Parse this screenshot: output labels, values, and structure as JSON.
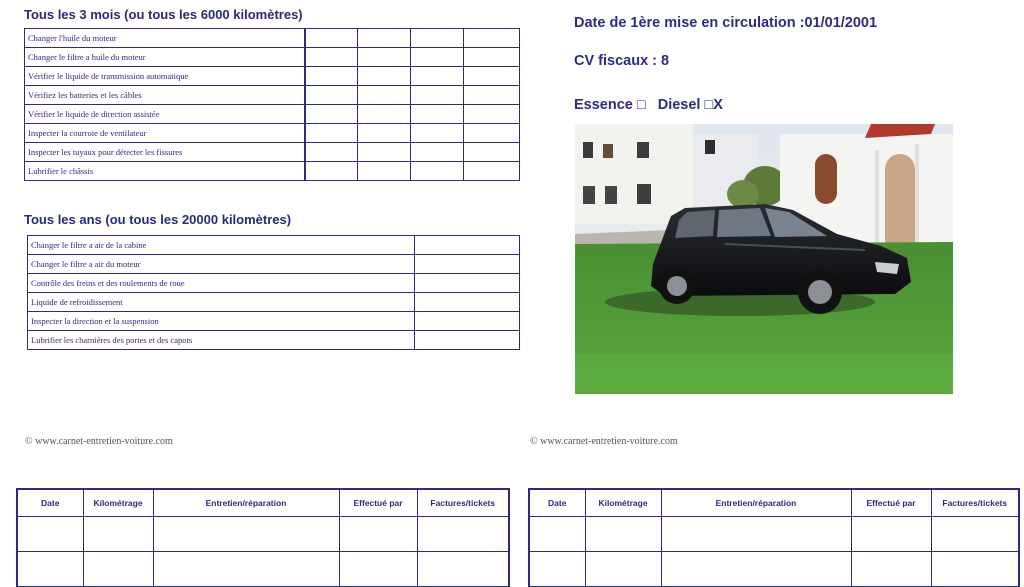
{
  "quarterly": {
    "title": "Tous les 3 mois (ou tous les 6000 kilomètres)",
    "items": [
      "Changer l'huile du moteur",
      "Changer le filtre a huile du moteur",
      "Vérifier le liquide de transmission automatique",
      "Vérifiez les batteries et les câbles",
      "Vérifier le liquide de direction assistée",
      "Inspecter la courroie de ventilateur",
      "Inspecter les tuyaux pour détecter les fissures",
      "Lubrifier le châssis"
    ]
  },
  "yearly": {
    "title": "Tous les ans (ou tous les 20000 kilomètres)",
    "items": [
      "Changer le filtre a air de la cabine",
      "Changer le filtre a air du moteur",
      "Contrôle des freins et des roulements de roue",
      "Liquide de refroidissement",
      "Inspecter la direction et la suspension",
      "Lubrifier les charnières des portes et des capots"
    ]
  },
  "vehicle": {
    "first_registration": "Date de 1ère mise en circulation :01/01/2001",
    "fiscal_hp": "CV fiscaux : 8",
    "fuel": "Essence □   Diesel □X"
  },
  "footer": {
    "copyright_left": "© www.carnet-entretien-voiture.com",
    "copyright_right": "© www.carnet-entretien-voiture.com"
  },
  "log_table": {
    "headers": [
      "Date",
      "Kilométrage",
      "Entretien/réparation",
      "Effectué par",
      "Factures/tickets"
    ]
  },
  "colors": {
    "ink": "#2b2b80",
    "grass": "#4f9a35",
    "car": "#111111"
  }
}
